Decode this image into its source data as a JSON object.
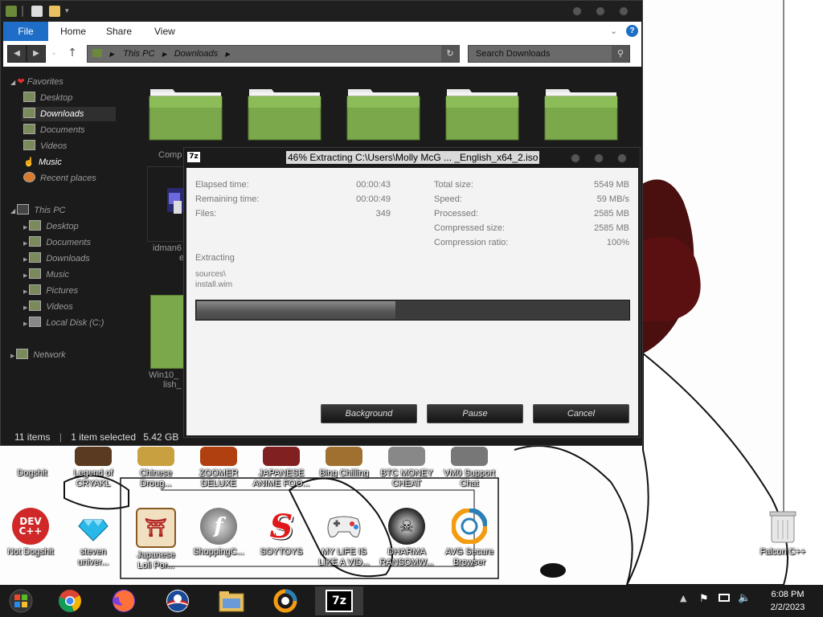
{
  "explorer": {
    "ribbon": {
      "file": "File",
      "home": "Home",
      "share": "Share",
      "view": "View"
    },
    "address": {
      "this_pc": "This PC",
      "downloads": "Downloads"
    },
    "search_placeholder": "Search Downloads",
    "nav": {
      "favorites": "Favorites",
      "fav_items": [
        "Desktop",
        "Downloads",
        "Documents",
        "Videos",
        "Music",
        "Recent places"
      ],
      "this_pc": "This PC",
      "pc_items": [
        "Desktop",
        "Documents",
        "Downloads",
        "Music",
        "Pictures",
        "Videos",
        "Local Disk (C:)"
      ],
      "network": "Network"
    },
    "files": {
      "f1": "Comp",
      "f2_a": "idman6",
      "f2_b": "e",
      "f3_a": "Win10_",
      "f3_b": "lish_"
    },
    "status": {
      "count": "11 items",
      "selected": "1 item selected",
      "size": "5.42 GB"
    }
  },
  "dialog": {
    "title": "46% Extracting C:\\Users\\Molly McG ... _English_x64_2.iso",
    "icon_label": "7z",
    "elapsed_label": "Elapsed time:",
    "elapsed": "00:00:43",
    "remaining_label": "Remaining time:",
    "remaining": "00:00:49",
    "files_label": "Files:",
    "files": "349",
    "total_label": "Total size:",
    "total": "5549 MB",
    "speed_label": "Speed:",
    "speed": "59 MB/s",
    "processed_label": "Processed:",
    "processed": "2585 MB",
    "compressed_label": "Compressed size:",
    "compressed": "2585 MB",
    "ratio_label": "Compression ratio:",
    "ratio": "100%",
    "action": "Extracting",
    "path": "sources\\",
    "file": "install.wim",
    "progress": 0.46,
    "background_btn": "Background",
    "pause_btn": "Pause",
    "cancel_btn": "Cancel"
  },
  "desktop": {
    "row1": [
      {
        "a": "Dogshit",
        "b": ""
      },
      {
        "a": "Legend of",
        "b": "CRYAKL"
      },
      {
        "a": "Chinese",
        "b": "Droug..."
      },
      {
        "a": "ZOOMER",
        "b": "DELUXE"
      },
      {
        "a": "JAPANESE",
        "b": "ANIME FOO..."
      },
      {
        "a": "Bing Chilling",
        "b": ""
      },
      {
        "a": "BTC MONEY",
        "b": "CHEAT"
      },
      {
        "a": "VM0 Support",
        "b": "Chat"
      }
    ],
    "row2": [
      {
        "a": "Not Dogshit",
        "b": ""
      },
      {
        "a": "steven",
        "b": "univer..."
      },
      {
        "a": "Japanese",
        "b": "Loli Por..."
      },
      {
        "a": "ShoppingC...",
        "b": ""
      },
      {
        "a": "SOYTOYS",
        "b": ""
      },
      {
        "a": "MY LIFE IS",
        "b": "LIKE A VID..."
      },
      {
        "a": "DHARMA",
        "b": "RANSOMW..."
      },
      {
        "a": "AVG Secure",
        "b": "Browser"
      }
    ],
    "recycle": "Falcon C++",
    "devcpp": "DEV\nC++"
  },
  "taskbar": {
    "time": "6:08 PM",
    "date": "2/2/2023",
    "zip": "7z"
  }
}
